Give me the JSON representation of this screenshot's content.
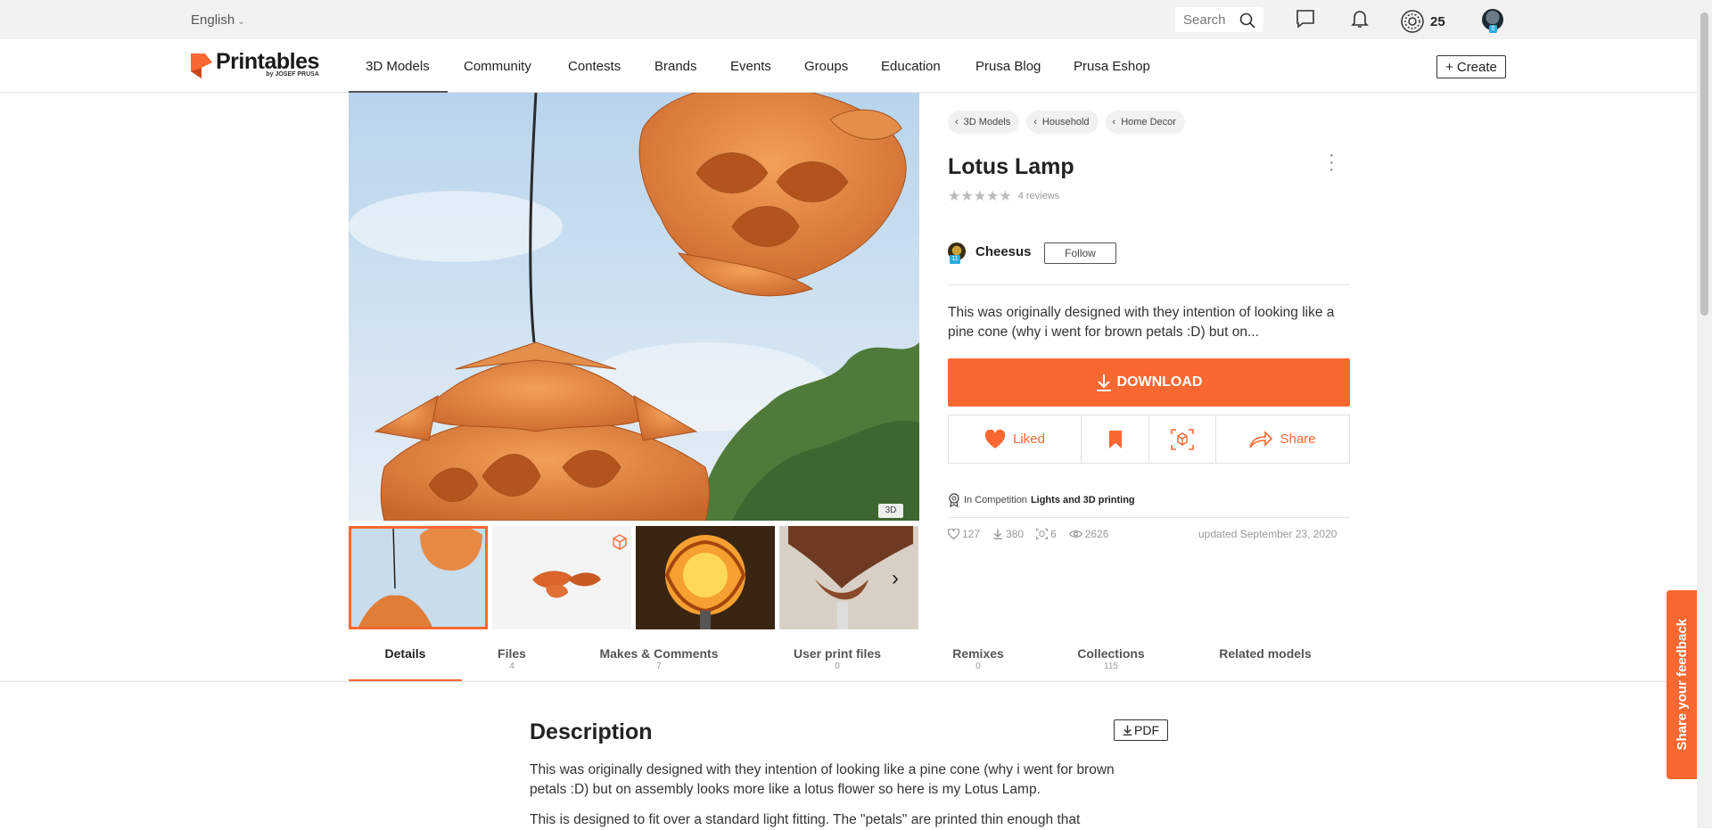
{
  "topbar": {
    "language": "English",
    "search_placeholder": "Search",
    "points": "25",
    "avatar_level": "0"
  },
  "navbar": {
    "logo_main": "Printables",
    "logo_sub": "by JOSEF PRUSA",
    "items": [
      "3D Models",
      "Community",
      "Contests",
      "Brands",
      "Events",
      "Groups",
      "Education",
      "Prusa Blog",
      "Prusa Eshop"
    ],
    "create_label": "Create"
  },
  "model": {
    "breadcrumbs": [
      "3D Models",
      "Household",
      "Home Decor"
    ],
    "title": "Lotus Lamp",
    "rating_stars": 0,
    "reviews": "4 reviews",
    "author": "Cheesus",
    "author_level": "11",
    "follow_label": "Follow",
    "summary": "This was originally designed with they intention of looking like a pine cone (why i went for brown petals :D) but on...",
    "download_label": "DOWNLOAD",
    "liked_label": "Liked",
    "share_label": "Share",
    "competition_prefix": "In Competition",
    "competition_name": "Lights and 3D printing",
    "stats": {
      "likes": "127",
      "downloads": "380",
      "makes": "6",
      "views": "2626"
    },
    "updated": "updated September 23, 2020",
    "badge_3d": "3D"
  },
  "tabs": [
    {
      "label": "Details",
      "count": ""
    },
    {
      "label": "Files",
      "count": "4"
    },
    {
      "label": "Makes & Comments",
      "count": "7"
    },
    {
      "label": "User print files",
      "count": "0"
    },
    {
      "label": "Remixes",
      "count": "0"
    },
    {
      "label": "Collections",
      "count": "115"
    },
    {
      "label": "Related models",
      "count": ""
    }
  ],
  "description": {
    "title": "Description",
    "pdf_label": "PDF",
    "paragraphs": [
      "This was originally designed with they intention of looking like a pine cone (why i went for brown petals :D) but on assembly looks more like a lotus flower so here is my Lotus Lamp.",
      "This is designed to fit over a standard light fitting. The \"petals\" are printed thin enough that"
    ]
  },
  "feedback_label": "Share your feedback",
  "colors": {
    "accent": "#fa6831",
    "topbar": "#f2f2f2",
    "sky": "#c9dff0",
    "petal": "#e8843e"
  }
}
